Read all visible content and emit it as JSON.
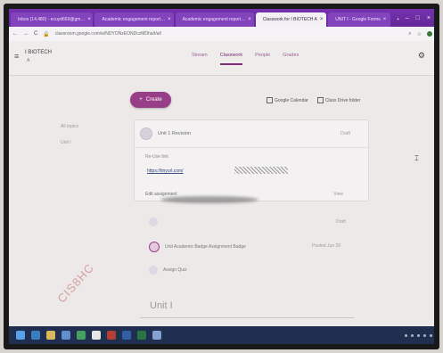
{
  "browser": {
    "tabs": [
      {
        "label": "Inbox (14,480) - ecuyd669@gm…",
        "active": false
      },
      {
        "label": "Academic engagement report…",
        "active": false
      },
      {
        "label": "Academic engagement report…",
        "active": false
      },
      {
        "label": "Classwork for I BIOTECH A",
        "active": true
      },
      {
        "label": "UNIT I - Google Forms",
        "active": false
      }
    ],
    "url": "classroom.google.com/w/NDYONzEONDczMDha/t/all"
  },
  "classroom": {
    "class_title": "I BIOTECH",
    "class_sub": "A",
    "nav": [
      "Stream",
      "Classwork",
      "People",
      "Grades"
    ],
    "active_nav": "Classwork"
  },
  "toolbar": {
    "create_label": "Create",
    "calendar_label": "Google Calendar",
    "drive_label": "Class Drive folder"
  },
  "sidebar": {
    "topics": [
      "All topics",
      "Unit I"
    ]
  },
  "unit_card": {
    "title": "Unit 1 Revision",
    "edited": "Draft",
    "link_label": "Re-Use link",
    "link_url": "https://tinyurl.com/",
    "edit_label": "Edit assignment",
    "more": "View"
  },
  "list_items": [
    {
      "label": "",
      "right": "Draft",
      "purple": false
    },
    {
      "label": "Unit Academic Badge Assignment Badge",
      "right": "Posted Jun 29",
      "purple": true
    },
    {
      "label": "Assign Quiz",
      "right": "",
      "purple": false
    }
  ],
  "unit_section": {
    "title": "Unit I"
  },
  "watermark": "CIS8HC",
  "colors": {
    "accent": "#a43a92",
    "tab_strip": "#7d2dc0",
    "taskbar": "#1e2f55"
  }
}
